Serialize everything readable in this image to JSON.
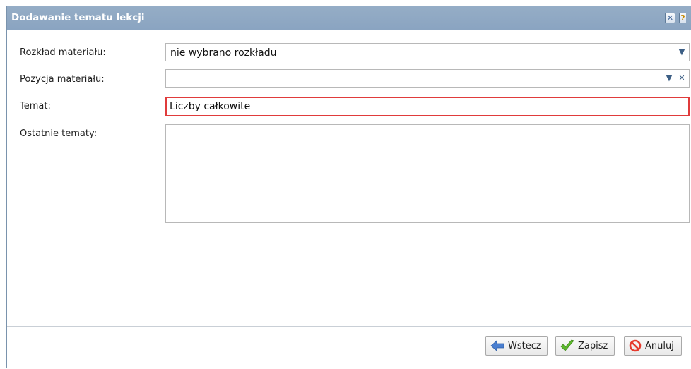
{
  "dialog": {
    "title": "Dodawanie tematu lekcji",
    "close_icon": "close-icon",
    "help_label": "?"
  },
  "form": {
    "rozklad_label": "Rozkład materiału:",
    "rozklad_value": "nie wybrano rozkładu",
    "pozycja_label": "Pozycja materiału:",
    "pozycja_value": "",
    "temat_label": "Temat:",
    "temat_value": "Liczby całkowite",
    "ostatnie_label": "Ostatnie tematy:",
    "ostatnie_value": ""
  },
  "buttons": {
    "back": "Wstecz",
    "save": "Zapisz",
    "cancel": "Anuluj"
  },
  "colors": {
    "titlebar": "#8aa4c1",
    "error_border": "#e03b3b"
  }
}
